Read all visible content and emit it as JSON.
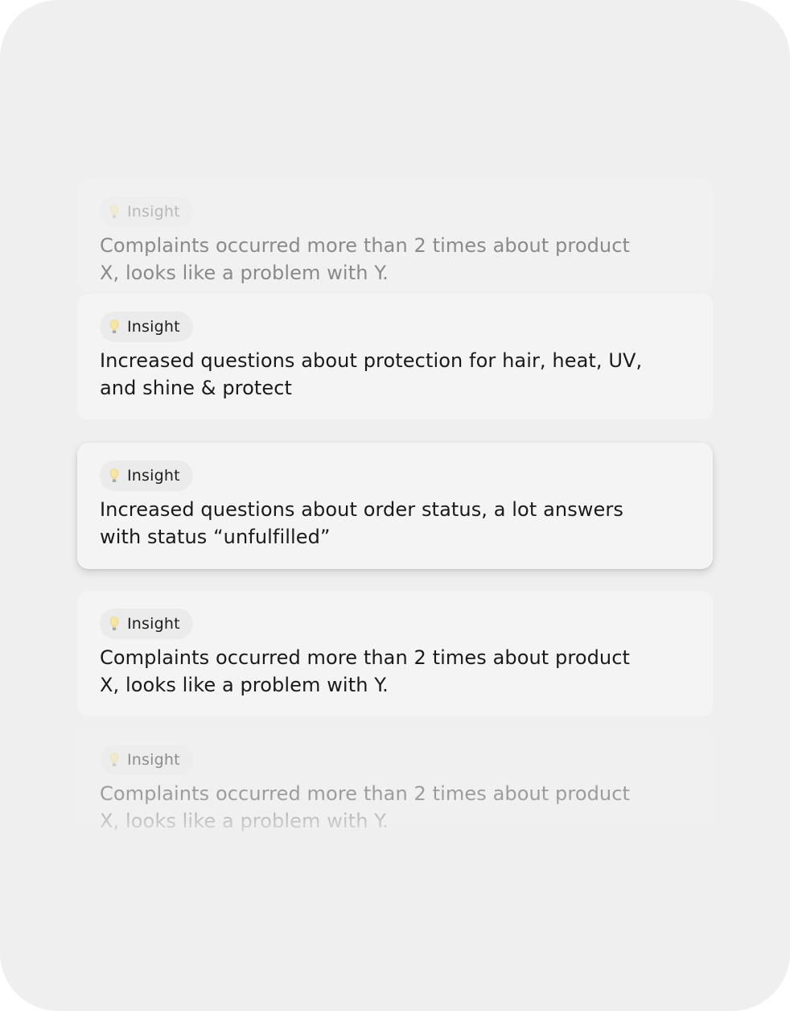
{
  "insights": [
    {
      "badge": "Insight",
      "text": "Complaints occurred more than 2 times about product X, looks like a problem with Y.",
      "state": "faded"
    },
    {
      "badge": "Insight",
      "text": "Increased questions about protection for hair, heat, UV, and shine & protect",
      "state": "normal"
    },
    {
      "badge": "Insight",
      "text": "Increased questions about order status, a lot answers with status “unfulfilled”",
      "state": "focused"
    },
    {
      "badge": "Insight",
      "text": "Complaints occurred more than 2 times about product X, looks like a problem with Y.",
      "state": "normal"
    },
    {
      "badge": "Insight",
      "text": "Complaints occurred more than 2 times about product X, looks like a problem with Y.",
      "state": "faded"
    }
  ],
  "badge_icon": "lightbulb-icon",
  "colors": {
    "panel_background": "#efefef",
    "card_background": "#f4f4f4",
    "badge_background": "#ebebeb",
    "text": "#1a1a1a",
    "bulb": "#f5e6a8"
  }
}
